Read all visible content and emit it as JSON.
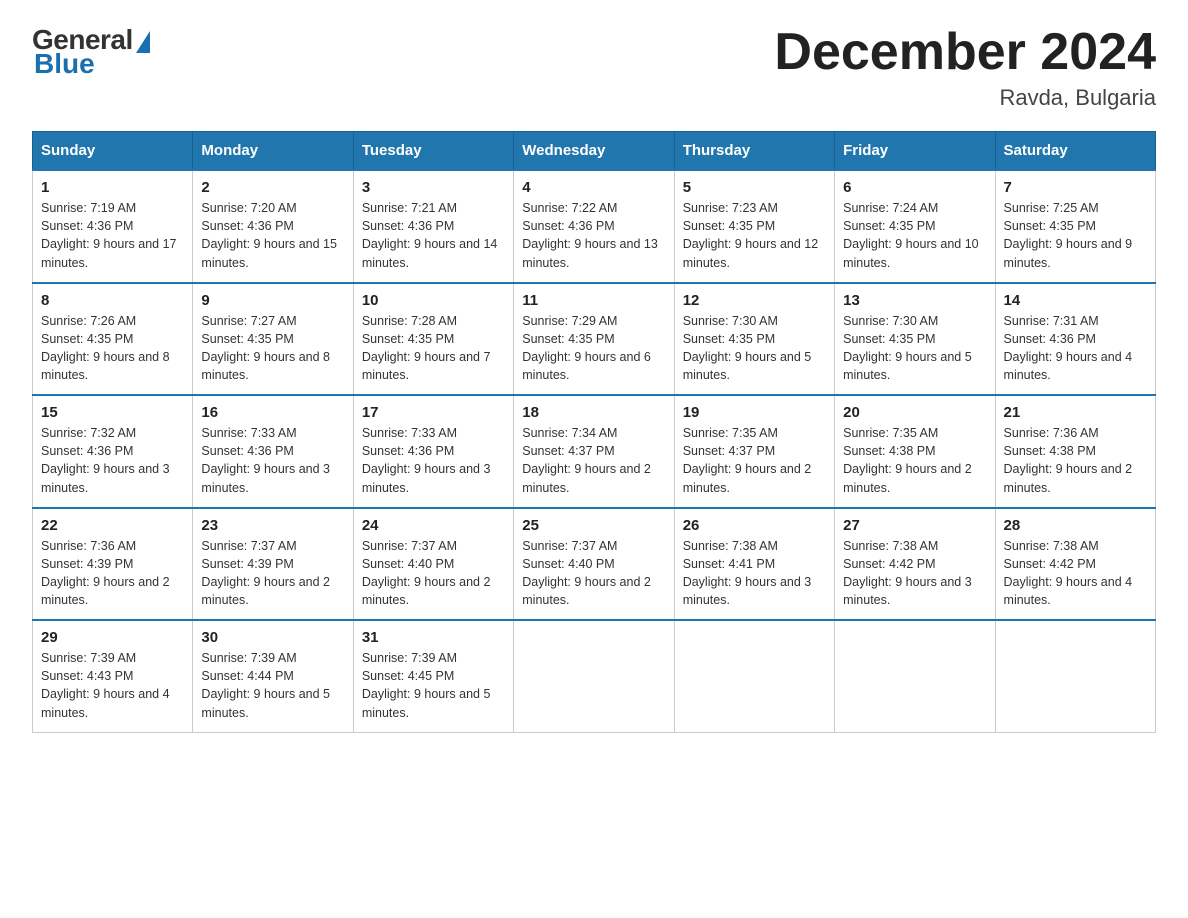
{
  "logo": {
    "general": "General",
    "blue": "Blue"
  },
  "title": "December 2024",
  "location": "Ravda, Bulgaria",
  "days_header": [
    "Sunday",
    "Monday",
    "Tuesday",
    "Wednesday",
    "Thursday",
    "Friday",
    "Saturday"
  ],
  "weeks": [
    [
      {
        "day": "1",
        "sunrise": "7:19 AM",
        "sunset": "4:36 PM",
        "daylight": "9 hours and 17 minutes."
      },
      {
        "day": "2",
        "sunrise": "7:20 AM",
        "sunset": "4:36 PM",
        "daylight": "9 hours and 15 minutes."
      },
      {
        "day": "3",
        "sunrise": "7:21 AM",
        "sunset": "4:36 PM",
        "daylight": "9 hours and 14 minutes."
      },
      {
        "day": "4",
        "sunrise": "7:22 AM",
        "sunset": "4:36 PM",
        "daylight": "9 hours and 13 minutes."
      },
      {
        "day": "5",
        "sunrise": "7:23 AM",
        "sunset": "4:35 PM",
        "daylight": "9 hours and 12 minutes."
      },
      {
        "day": "6",
        "sunrise": "7:24 AM",
        "sunset": "4:35 PM",
        "daylight": "9 hours and 10 minutes."
      },
      {
        "day": "7",
        "sunrise": "7:25 AM",
        "sunset": "4:35 PM",
        "daylight": "9 hours and 9 minutes."
      }
    ],
    [
      {
        "day": "8",
        "sunrise": "7:26 AM",
        "sunset": "4:35 PM",
        "daylight": "9 hours and 8 minutes."
      },
      {
        "day": "9",
        "sunrise": "7:27 AM",
        "sunset": "4:35 PM",
        "daylight": "9 hours and 8 minutes."
      },
      {
        "day": "10",
        "sunrise": "7:28 AM",
        "sunset": "4:35 PM",
        "daylight": "9 hours and 7 minutes."
      },
      {
        "day": "11",
        "sunrise": "7:29 AM",
        "sunset": "4:35 PM",
        "daylight": "9 hours and 6 minutes."
      },
      {
        "day": "12",
        "sunrise": "7:30 AM",
        "sunset": "4:35 PM",
        "daylight": "9 hours and 5 minutes."
      },
      {
        "day": "13",
        "sunrise": "7:30 AM",
        "sunset": "4:35 PM",
        "daylight": "9 hours and 5 minutes."
      },
      {
        "day": "14",
        "sunrise": "7:31 AM",
        "sunset": "4:36 PM",
        "daylight": "9 hours and 4 minutes."
      }
    ],
    [
      {
        "day": "15",
        "sunrise": "7:32 AM",
        "sunset": "4:36 PM",
        "daylight": "9 hours and 3 minutes."
      },
      {
        "day": "16",
        "sunrise": "7:33 AM",
        "sunset": "4:36 PM",
        "daylight": "9 hours and 3 minutes."
      },
      {
        "day": "17",
        "sunrise": "7:33 AM",
        "sunset": "4:36 PM",
        "daylight": "9 hours and 3 minutes."
      },
      {
        "day": "18",
        "sunrise": "7:34 AM",
        "sunset": "4:37 PM",
        "daylight": "9 hours and 2 minutes."
      },
      {
        "day": "19",
        "sunrise": "7:35 AM",
        "sunset": "4:37 PM",
        "daylight": "9 hours and 2 minutes."
      },
      {
        "day": "20",
        "sunrise": "7:35 AM",
        "sunset": "4:38 PM",
        "daylight": "9 hours and 2 minutes."
      },
      {
        "day": "21",
        "sunrise": "7:36 AM",
        "sunset": "4:38 PM",
        "daylight": "9 hours and 2 minutes."
      }
    ],
    [
      {
        "day": "22",
        "sunrise": "7:36 AM",
        "sunset": "4:39 PM",
        "daylight": "9 hours and 2 minutes."
      },
      {
        "day": "23",
        "sunrise": "7:37 AM",
        "sunset": "4:39 PM",
        "daylight": "9 hours and 2 minutes."
      },
      {
        "day": "24",
        "sunrise": "7:37 AM",
        "sunset": "4:40 PM",
        "daylight": "9 hours and 2 minutes."
      },
      {
        "day": "25",
        "sunrise": "7:37 AM",
        "sunset": "4:40 PM",
        "daylight": "9 hours and 2 minutes."
      },
      {
        "day": "26",
        "sunrise": "7:38 AM",
        "sunset": "4:41 PM",
        "daylight": "9 hours and 3 minutes."
      },
      {
        "day": "27",
        "sunrise": "7:38 AM",
        "sunset": "4:42 PM",
        "daylight": "9 hours and 3 minutes."
      },
      {
        "day": "28",
        "sunrise": "7:38 AM",
        "sunset": "4:42 PM",
        "daylight": "9 hours and 4 minutes."
      }
    ],
    [
      {
        "day": "29",
        "sunrise": "7:39 AM",
        "sunset": "4:43 PM",
        "daylight": "9 hours and 4 minutes."
      },
      {
        "day": "30",
        "sunrise": "7:39 AM",
        "sunset": "4:44 PM",
        "daylight": "9 hours and 5 minutes."
      },
      {
        "day": "31",
        "sunrise": "7:39 AM",
        "sunset": "4:45 PM",
        "daylight": "9 hours and 5 minutes."
      },
      null,
      null,
      null,
      null
    ]
  ]
}
